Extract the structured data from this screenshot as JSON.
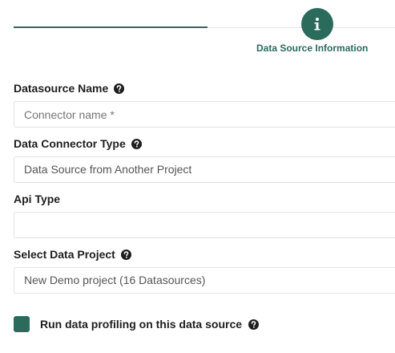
{
  "stepper": {
    "current_step_label": "Data Source Information",
    "current_step_icon": "info-icon",
    "accent_color": "#2b6b5c"
  },
  "form": {
    "datasource_name": {
      "label": "Datasource Name",
      "value": "",
      "placeholder": "Connector name *",
      "help_icon": "question-circle-icon"
    },
    "data_connector_type": {
      "label": "Data Connector Type",
      "value": "Data Source from Another Project",
      "help_icon": "question-circle-icon"
    },
    "api_type": {
      "label": "Api Type",
      "value": ""
    },
    "select_data_project": {
      "label": "Select Data Project",
      "value": "New Demo project (16 Datasources)",
      "help_icon": "question-circle-icon"
    },
    "profiling": {
      "label": "Run data profiling on this data source",
      "checked": true,
      "help_icon": "question-circle-icon"
    }
  }
}
